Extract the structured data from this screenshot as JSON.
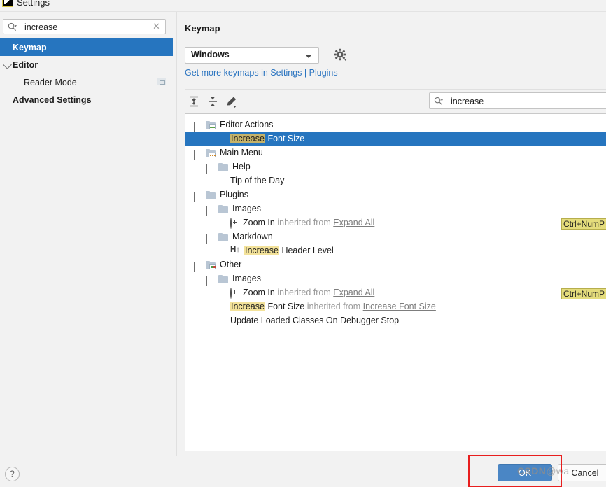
{
  "window": {
    "title": "Settings",
    "app_icon": "ide-icon"
  },
  "sidebar": {
    "search": {
      "value": "increase",
      "placeholder": "",
      "icon": "search-icon",
      "clear_icon": "✕"
    },
    "items": [
      {
        "label": "Keymap",
        "selected": true,
        "bold": true,
        "indent": 18,
        "arrow": "",
        "badge": false
      },
      {
        "label": "Editor",
        "selected": false,
        "bold": true,
        "indent": 18,
        "arrow": "chevron-down",
        "badge": false
      },
      {
        "label": "Reader Mode",
        "selected": false,
        "bold": false,
        "indent": 34,
        "arrow": "",
        "badge": true
      },
      {
        "label": "Advanced Settings",
        "selected": false,
        "bold": true,
        "indent": 18,
        "arrow": "",
        "badge": false
      }
    ]
  },
  "main": {
    "title": "Keymap",
    "keymap_select": {
      "value": "Windows",
      "caret_icon": "chevron-down-icon"
    },
    "gear_icon": "gear-icon",
    "link_prefix": "Get more keymaps in ",
    "link_settings": "Settings",
    "link_separator": " | ",
    "link_plugins": "Plugins",
    "toolbar": {
      "expand_all": "expand-all-icon",
      "collapse_all": "collapse-all-icon",
      "edit_shortcut": "edit-pencil-icon"
    },
    "tree_search": {
      "value": "increase",
      "placeholder": "",
      "icon": "search-icon"
    },
    "tree": [
      {
        "indent": 12,
        "arrow": "chevron-down",
        "icon": "folder-chart-icon",
        "text": "Editor Actions",
        "highlight": "",
        "selected": false,
        "inherited": "",
        "shortcut": ""
      },
      {
        "indent": 64,
        "arrow": "",
        "icon": "",
        "text": "Font Size",
        "highlight": "Increase",
        "selected": true,
        "inherited": "",
        "shortcut": ""
      },
      {
        "indent": 12,
        "arrow": "chevron-down",
        "icon": "folder-menu-icon",
        "text": "Main Menu",
        "highlight": "",
        "selected": false,
        "inherited": "",
        "shortcut": ""
      },
      {
        "indent": 30,
        "arrow": "chevron-down",
        "icon": "folder-icon",
        "text": "Help",
        "highlight": "",
        "selected": false,
        "inherited": "",
        "shortcut": ""
      },
      {
        "indent": 64,
        "arrow": "",
        "icon": "",
        "text": "Tip of the Day",
        "highlight": "",
        "selected": false,
        "inherited": "",
        "shortcut": ""
      },
      {
        "indent": 12,
        "arrow": "chevron-down",
        "icon": "folder-icon",
        "text": "Plugins",
        "highlight": "",
        "selected": false,
        "inherited": "",
        "shortcut": ""
      },
      {
        "indent": 30,
        "arrow": "chevron-down",
        "icon": "folder-icon",
        "text": "Images",
        "highlight": "",
        "selected": false,
        "inherited": "",
        "shortcut": ""
      },
      {
        "indent": 64,
        "arrow": "",
        "icon": "zoom-in-icon",
        "text": "Zoom In",
        "highlight": "",
        "selected": false,
        "inherited": "Expand All",
        "inherited_prefix": "inherited from",
        "shortcut": "Ctrl+NumP"
      },
      {
        "indent": 30,
        "arrow": "chevron-down",
        "icon": "folder-icon",
        "text": "Markdown",
        "highlight": "",
        "selected": false,
        "inherited": "",
        "shortcut": ""
      },
      {
        "indent": 64,
        "arrow": "",
        "icon": "header-up-icon",
        "text": "Header Level",
        "highlight": "Increase",
        "selected": false,
        "inherited": "",
        "shortcut": "",
        "glyph": "H↑"
      },
      {
        "indent": 12,
        "arrow": "chevron-down",
        "icon": "folder-other-icon",
        "text": "Other",
        "highlight": "",
        "selected": false,
        "inherited": "",
        "shortcut": ""
      },
      {
        "indent": 30,
        "arrow": "chevron-down",
        "icon": "folder-icon",
        "text": "Images",
        "highlight": "",
        "selected": false,
        "inherited": "",
        "shortcut": ""
      },
      {
        "indent": 64,
        "arrow": "",
        "icon": "zoom-in-icon",
        "text": "Zoom In",
        "highlight": "",
        "selected": false,
        "inherited": "Expand All",
        "inherited_prefix": "inherited from",
        "shortcut": "Ctrl+NumP"
      },
      {
        "indent": 64,
        "arrow": "",
        "icon": "",
        "text": "Font Size",
        "highlight": "Increase",
        "selected": false,
        "inherited": "Increase Font Size",
        "inherited_prefix": "inherited from",
        "shortcut": ""
      },
      {
        "indent": 64,
        "arrow": "",
        "icon": "",
        "text": "Update Loaded Classes On Debugger Stop",
        "highlight": "",
        "selected": false,
        "inherited": "",
        "shortcut": ""
      }
    ]
  },
  "footer": {
    "help_label": "?",
    "ok_label": "OK",
    "cancel_label": "Cancel"
  },
  "overlay": {
    "watermark_main": "CSDN",
    "watermark_user": "@wa",
    "annotation": "red-highlight-rectangle"
  },
  "colors": {
    "accent": "#2675bf",
    "button_primary": "#4a86c5",
    "highlight": "#f3e29a",
    "shortcut_badge": "#e4dc7c",
    "link": "#2a74c0",
    "annotation_red": "#e81e1e"
  }
}
